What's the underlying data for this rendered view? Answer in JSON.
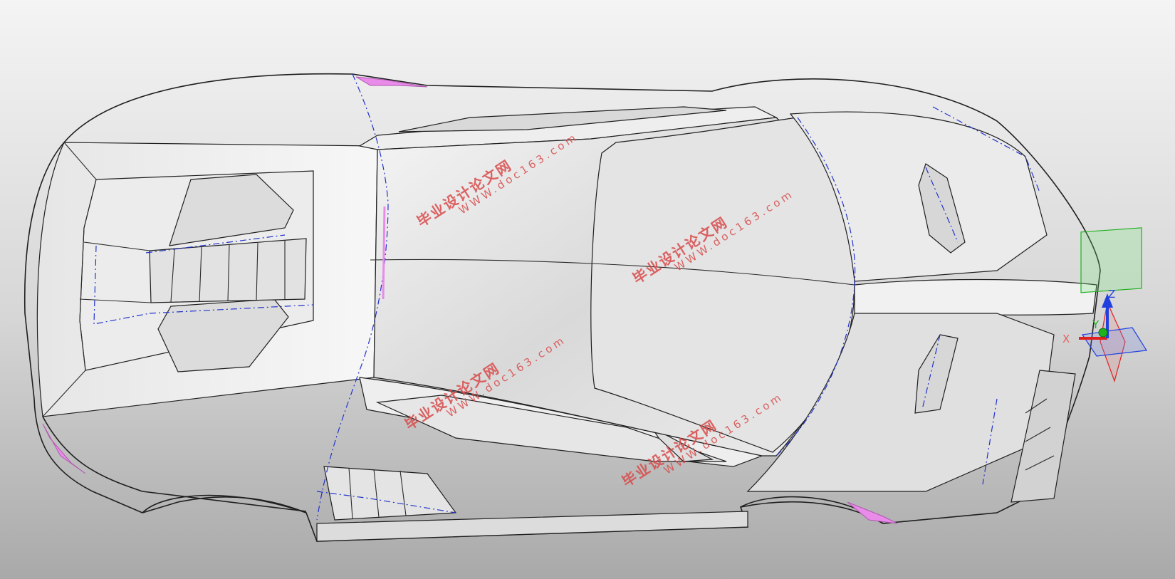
{
  "watermarks": [
    {
      "cn": "毕业设计论文网",
      "url": "WWW.doc163.com"
    },
    {
      "cn": "毕业设计论文网",
      "url": "WWW.doc163.com"
    },
    {
      "cn": "毕业设计论文网",
      "url": "WWW.doc163.com"
    },
    {
      "cn": "毕业设计论文网",
      "url": "WWW.doc163.com"
    }
  ],
  "triad": {
    "x_label": "X",
    "y_label": "Y",
    "z_label": "Z",
    "colors": {
      "x": "#e02020",
      "y": "#20b020",
      "z": "#2040e0",
      "seam": "#2233cc",
      "highlight": "#e98be9"
    }
  }
}
